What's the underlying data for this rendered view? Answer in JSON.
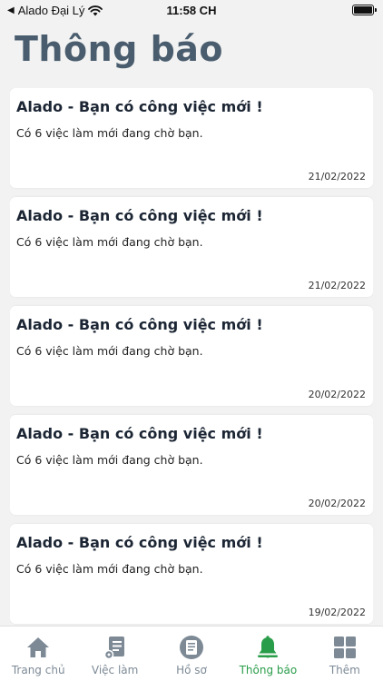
{
  "status_bar": {
    "back_label": "◀",
    "carrier": "Alado Đại Lý",
    "time": "11:58 CH"
  },
  "page": {
    "title": "Thông báo"
  },
  "notifications": [
    {
      "title": "Alado - Bạn có công việc mới !",
      "body": "Có 6 việc làm mới đang chờ bạn.",
      "date": "21/02/2022"
    },
    {
      "title": "Alado - Bạn có công việc mới !",
      "body": "Có 6 việc làm mới đang chờ bạn.",
      "date": "21/02/2022"
    },
    {
      "title": "Alado - Bạn có công việc mới !",
      "body": "Có 6 việc làm mới đang chờ bạn.",
      "date": "20/02/2022"
    },
    {
      "title": "Alado - Bạn có công việc mới !",
      "body": "Có 6 việc làm mới đang chờ bạn.",
      "date": "20/02/2022"
    },
    {
      "title": "Alado - Bạn có công việc mới !",
      "body": "Có 6 việc làm mới đang chờ bạn.",
      "date": "19/02/2022"
    }
  ],
  "tab_bar": {
    "active_color": "#2a9d4a",
    "inactive_color": "#7d8a96",
    "tabs": [
      {
        "label": "Trang chủ",
        "icon": "home-icon"
      },
      {
        "label": "Việc làm",
        "icon": "job-list-icon"
      },
      {
        "label": "Hồ sơ",
        "icon": "profile-document-icon"
      },
      {
        "label": "Thông báo",
        "icon": "bell-icon"
      },
      {
        "label": "Thêm",
        "icon": "grid-icon"
      }
    ]
  }
}
